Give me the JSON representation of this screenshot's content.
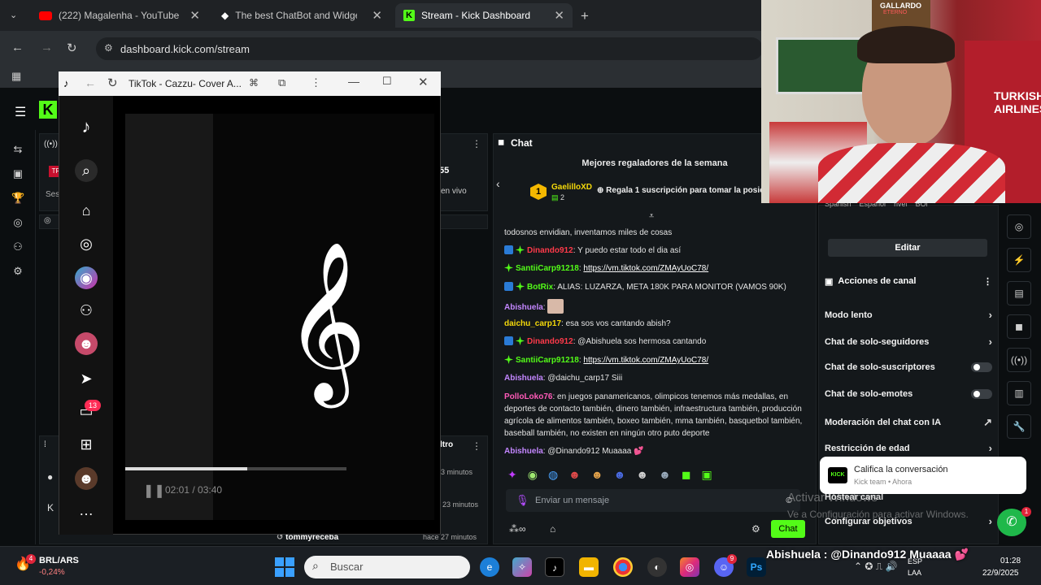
{
  "colors": {
    "kick_green": "#53fc18",
    "tab_bg": "#1f2225",
    "panel": "#14181b"
  },
  "tabs": [
    {
      "label": "(222) Magalenha - YouTube",
      "icon": "youtube-icon"
    },
    {
      "label": "The best ChatBot and Widgets",
      "icon": "diamond-icon"
    },
    {
      "label": "Stream - Kick Dashboard",
      "icon": "kick-icon"
    }
  ],
  "address": {
    "url": "dashboard.kick.com/stream"
  },
  "tiktok": {
    "title": "TikTok - Cazzu- Cover A...",
    "badge_count": "13",
    "time": "02:01 / 03:40",
    "progress": 0.55
  },
  "kick": {
    "side_fragments": {
      "viewers": "55",
      "live": "en vivo",
      "filter": "ltro",
      "ago1": "hace 3 minutos",
      "ago2": "23 minutos",
      "ago3": "hace 27 minutos",
      "user": "tommyreceba",
      "trunc1": "TR",
      "trunc2": "Ses"
    }
  },
  "chat": {
    "header": "Chat",
    "gifters_title": "Mejores regaladores de la semana",
    "top_gifter": {
      "rank": "1",
      "name": "GaelilloXD",
      "count": "2"
    },
    "gift_prompt": "Regala 1 suscripción para tomar la posic",
    "messages": [
      {
        "user": "",
        "text": "todosnos envidian, inventamos miles de cosas",
        "cls": ""
      },
      {
        "user": "Dinando912",
        "text": ": Y puedo estar todo el dia así",
        "cls": "u-red"
      },
      {
        "user": "SantiiCarp91218",
        "text": ": ",
        "link": "https://vm.tiktok.com/ZMAyUoC78/",
        "cls": "u-green"
      },
      {
        "user": "BotRix",
        "text": ": ALIAS: LUZARZA, META 180K PARA MONITOR (VAMOS 90K)",
        "cls": "u-green"
      },
      {
        "user": "Abishuela",
        "text": ": ",
        "cls": "u-purple"
      },
      {
        "user": "daichu_carp17",
        "text": ": esa sos vos cantando abish?",
        "cls": "u-yellow"
      },
      {
        "user": "Dinando912",
        "text": ": @Abishuela sos hermosa cantando",
        "cls": "u-red"
      },
      {
        "user": "SantiiCarp91218",
        "text": ": ",
        "link": "https://vm.tiktok.com/ZMAyUoC78/",
        "cls": "u-green"
      },
      {
        "user": "Abishuela",
        "text": ": @daichu_carp17 Siii",
        "cls": "u-purple"
      },
      {
        "user": "PolloLoko76",
        "text": ": en juegos panamericanos, olimpicos tenemos más medallas, en deportes de contacto también, dinero también, infraestructura también, producción agrícola de alimentos también, boxeo también, mma también, basquetbol también, baseball también, no existen en ningún otro puto deporte",
        "cls": "u-pink"
      },
      {
        "user": "Abishuela",
        "text": ": @Dinando912 Muaaaa 💕",
        "cls": "u-purple"
      }
    ],
    "input_placeholder": "Enviar un mensaje",
    "send_label": "Chat"
  },
  "panel": {
    "tags": [
      "Spanish",
      "Español",
      "rivel",
      "BOl"
    ],
    "edit_label": "Editar",
    "actions_title": "Acciones de canal",
    "settings": [
      {
        "label": "Modo lento",
        "control": "chevron"
      },
      {
        "label": "Chat de solo-seguidores",
        "control": "chevron"
      },
      {
        "label": "Chat de solo-suscriptores",
        "control": "toggle"
      },
      {
        "label": "Chat de solo-emotes",
        "control": "toggle"
      },
      {
        "label": "Moderación del chat con IA",
        "control": "external"
      },
      {
        "label": "Restricción de edad",
        "control": "chevron"
      }
    ],
    "host": "Hostear canal",
    "goals": "Configurar objetivos"
  },
  "toast": {
    "title": "Califica la conversación",
    "sub": "Kick team • Ahora",
    "badge": "KICK"
  },
  "watermark": {
    "line1": "Activar Windows",
    "line2": "Ve a Configuración para activar Windows."
  },
  "overlay": {
    "text": "Abishuela : @Dinando912 Muaaaa 💕"
  },
  "taskbar": {
    "weather_badge": "4",
    "market": "BRL/ARS",
    "change": "-0,24%",
    "search": "Buscar",
    "discord_badge": "9",
    "lang": "ESP",
    "lang2": "LAA",
    "time": "01:28",
    "date": "22/9/2025"
  },
  "webcam": {
    "poster_top": "GALLARDO",
    "poster_sub": "ETERNO",
    "jersey": "TURKISH AIRLINES"
  }
}
